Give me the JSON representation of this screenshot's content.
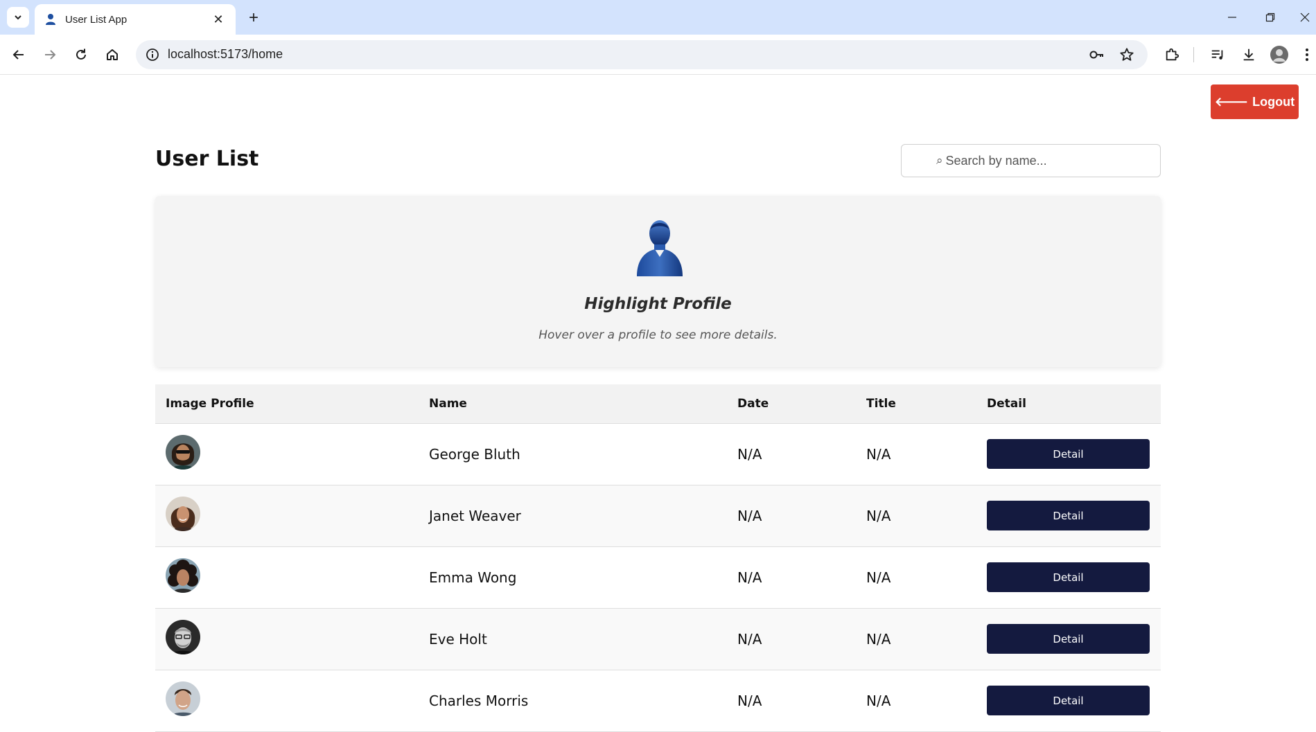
{
  "browser": {
    "tab_title": "User List App",
    "url": "localhost:5173/home"
  },
  "header": {
    "logout_label": "Logout"
  },
  "page": {
    "title": "User List",
    "search_placeholder": "Search by name..."
  },
  "highlight": {
    "title": "Highlight Profile",
    "subtitle": "Hover over a profile to see more details."
  },
  "table": {
    "columns": [
      "Image Profile",
      "Name",
      "Date",
      "Title",
      "Detail"
    ],
    "rows": [
      {
        "name": "George Bluth",
        "date": "N/A",
        "title": "N/A",
        "detail": "Detail"
      },
      {
        "name": "Janet Weaver",
        "date": "N/A",
        "title": "N/A",
        "detail": "Detail"
      },
      {
        "name": "Emma Wong",
        "date": "N/A",
        "title": "N/A",
        "detail": "Detail"
      },
      {
        "name": "Eve Holt",
        "date": "N/A",
        "title": "N/A",
        "detail": "Detail"
      },
      {
        "name": "Charles Morris",
        "date": "N/A",
        "title": "N/A",
        "detail": "Detail"
      }
    ]
  },
  "colors": {
    "logout": "#dc3e2d",
    "detail_button": "#141a3f",
    "tabbar": "#d3e3fd"
  },
  "icons": [
    "tab-dropdown-icon",
    "user-favicon-icon",
    "close-icon",
    "plus-icon",
    "minimize-icon",
    "restore-icon",
    "window-close-icon",
    "back-arrow-icon",
    "forward-arrow-icon",
    "reload-icon",
    "home-icon",
    "info-icon",
    "key-icon",
    "star-icon",
    "extensions-icon",
    "media-icon",
    "download-icon",
    "profile-avatar-icon",
    "more-icon",
    "arrow-left-icon",
    "search-icon",
    "user-silhouette-icon"
  ]
}
